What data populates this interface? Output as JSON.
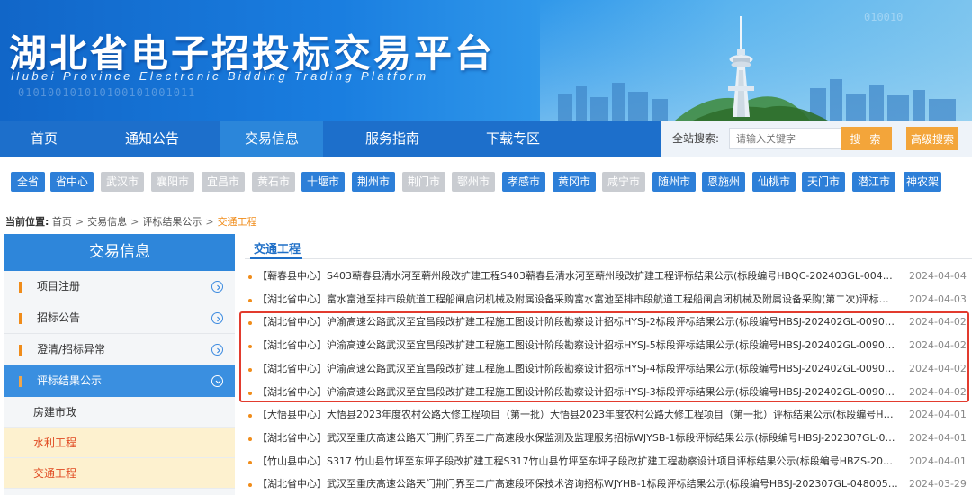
{
  "header": {
    "title_cn": "湖北省电子招投标交易平台",
    "title_en": "Hubei Province Electronic Bidding Trading Platform",
    "binary_text": "010100101010100101001011",
    "binary_text2": "010010"
  },
  "nav": {
    "items": [
      "首页",
      "通知公告",
      "交易信息",
      "服务指南",
      "下载专区"
    ],
    "active_index": 2,
    "search_label": "全站搜索:",
    "search_placeholder": "请输入关键字",
    "search_button": "搜 索",
    "advanced_button": "高级搜索"
  },
  "regions": [
    {
      "label": "全省",
      "enabled": true
    },
    {
      "label": "省中心",
      "enabled": true
    },
    {
      "label": "武汉市",
      "enabled": false
    },
    {
      "label": "襄阳市",
      "enabled": false
    },
    {
      "label": "宜昌市",
      "enabled": false
    },
    {
      "label": "黄石市",
      "enabled": false
    },
    {
      "label": "十堰市",
      "enabled": true
    },
    {
      "label": "荆州市",
      "enabled": true
    },
    {
      "label": "荆门市",
      "enabled": false
    },
    {
      "label": "鄂州市",
      "enabled": false
    },
    {
      "label": "孝感市",
      "enabled": true
    },
    {
      "label": "黄冈市",
      "enabled": true
    },
    {
      "label": "咸宁市",
      "enabled": false
    },
    {
      "label": "随州市",
      "enabled": true
    },
    {
      "label": "恩施州",
      "enabled": true
    },
    {
      "label": "仙桃市",
      "enabled": true
    },
    {
      "label": "天门市",
      "enabled": true
    },
    {
      "label": "潜江市",
      "enabled": true
    },
    {
      "label": "神农架",
      "enabled": true
    }
  ],
  "breadcrumb": {
    "label": "当前位置:",
    "items": [
      "首页",
      "交易信息",
      "评标结果公示"
    ],
    "current": "交通工程",
    "separator": ">"
  },
  "sidebar": {
    "title": "交易信息",
    "items": [
      {
        "label": "项目注册",
        "active": false
      },
      {
        "label": "招标公告",
        "active": false
      },
      {
        "label": "澄清/招标异常",
        "active": false
      },
      {
        "label": "评标结果公示",
        "active": true
      }
    ],
    "subitems": [
      {
        "label": "房建市政",
        "highlight": false
      },
      {
        "label": "水利工程",
        "highlight": true
      },
      {
        "label": "交通工程",
        "highlight": true
      }
    ]
  },
  "content": {
    "section_title": "交通工程",
    "rows": [
      {
        "text": "【蕲春县中心】S403蕲春县清水河至蕲州段改扩建工程S403蕲春县清水河至蕲州段改扩建工程评标结果公示(标段编号HBQC-202403GL-004001...",
        "date": "2024-04-04"
      },
      {
        "text": "【湖北省中心】富水富池至排市段航道工程船闸启闭机械及附属设备采购富水富池至排市段航道工程船闸启闭机械及附属设备采购(第二次)评标结...",
        "date": "2024-04-03"
      },
      {
        "text": "【湖北省中心】沪渝高速公路武汉至宜昌段改扩建工程施工图设计阶段勘察设计招标HYSJ-2标段评标结果公示(标段编号HBSJ-202402GL-009001...",
        "date": "2024-04-02"
      },
      {
        "text": "【湖北省中心】沪渝高速公路武汉至宜昌段改扩建工程施工图设计阶段勘察设计招标HYSJ-5标段评标结果公示(标段编号HBSJ-202402GL-009001...",
        "date": "2024-04-02"
      },
      {
        "text": "【湖北省中心】沪渝高速公路武汉至宜昌段改扩建工程施工图设计阶段勘察设计招标HYSJ-4标段评标结果公示(标段编号HBSJ-202402GL-009001...",
        "date": "2024-04-02"
      },
      {
        "text": "【湖北省中心】沪渝高速公路武汉至宜昌段改扩建工程施工图设计阶段勘察设计招标HYSJ-3标段评标结果公示(标段编号HBSJ-202402GL-009001...",
        "date": "2024-04-02"
      },
      {
        "text": "【大悟县中心】大悟县2023年度农村公路大修工程项目（第一批）大悟县2023年度农村公路大修工程项目（第一批）评标结果公示(标段编号HBD...",
        "date": "2024-04-01"
      },
      {
        "text": "【湖北省中心】武汉至重庆高速公路天门荆门界至二广高速段水保监测及监理服务招标WJYSB-1标段评标结果公示(标段编号HBSJ-202307GL-048...",
        "date": "2024-04-01"
      },
      {
        "text": "【竹山县中心】S317 竹山县竹坪至东坪子段改扩建工程S317竹山县竹坪至东坪子段改扩建工程勘察设计项目评标结果公示(标段编号HBZS-20240...",
        "date": "2024-04-01"
      },
      {
        "text": "【湖北省中心】武汉至重庆高速公路天门荆门界至二广高速段环保技术咨询招标WJYHB-1标段评标结果公示(标段编号HBSJ-202307GL-0480050...",
        "date": "2024-03-29"
      }
    ]
  },
  "colors": {
    "primary": "#1d6fcb",
    "accent": "#f3a53a",
    "highlight_box": "#e23b2e",
    "date": "#888888"
  }
}
